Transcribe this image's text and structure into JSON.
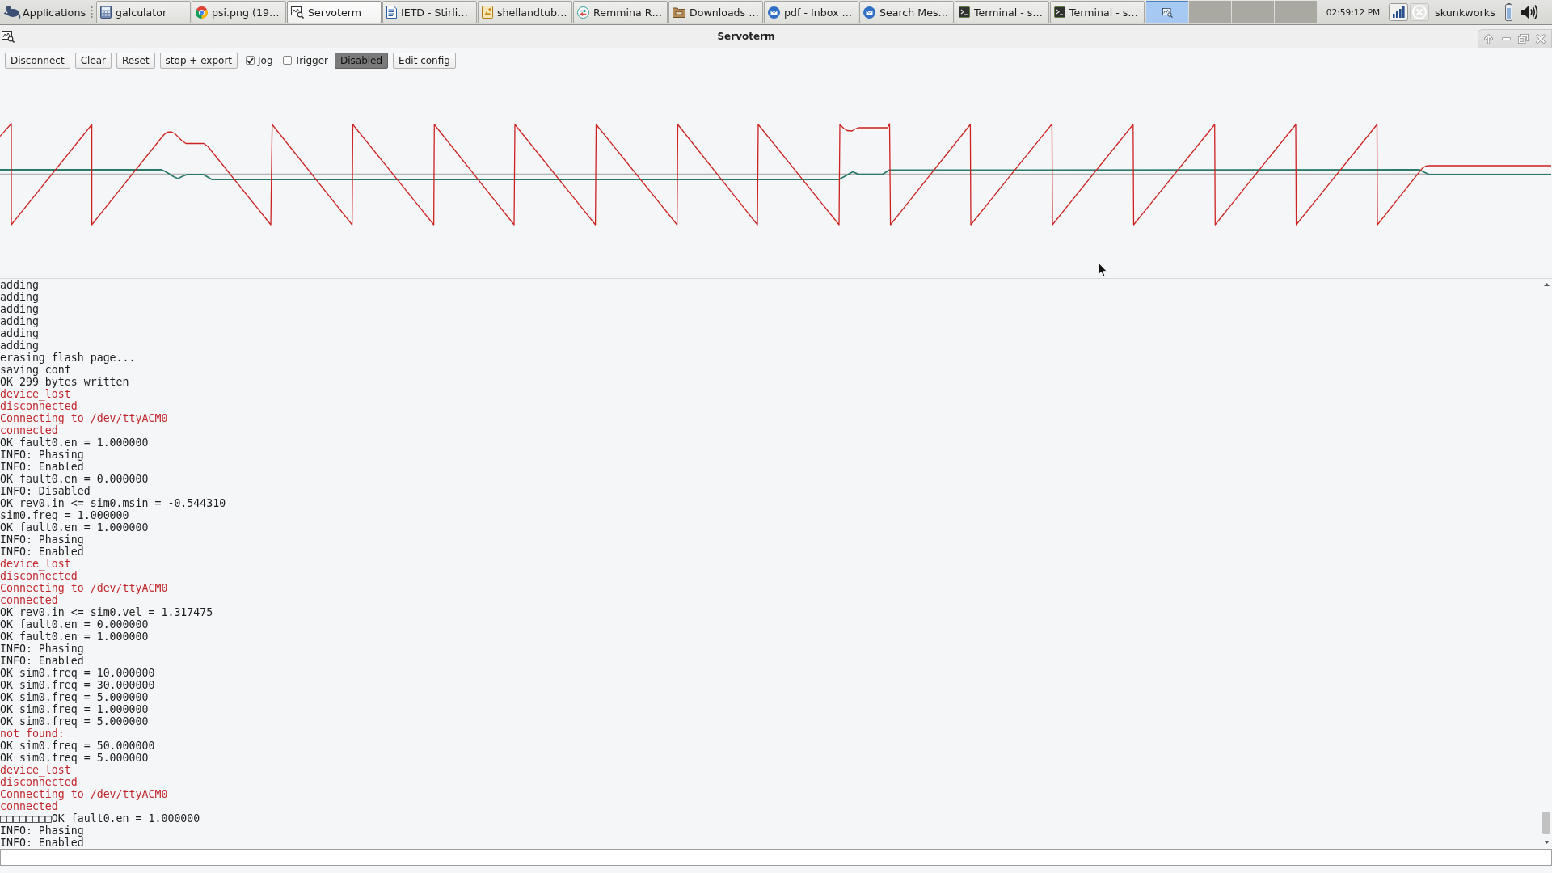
{
  "taskbar": {
    "menu": {
      "label": "Applications"
    },
    "tasks": [
      {
        "label": "galculator",
        "selected": false
      },
      {
        "label": "psi.png (19…",
        "selected": false
      },
      {
        "label": "Servoterm",
        "selected": true
      },
      {
        "label": "IETD - Stirli…",
        "selected": false
      },
      {
        "label": "shellandtub…",
        "selected": false
      },
      {
        "label": "Remmina R…",
        "selected": false
      },
      {
        "label": "Downloads …",
        "selected": false
      },
      {
        "label": "pdf - Inbox …",
        "selected": false
      },
      {
        "label": "Search Mes…",
        "selected": false
      },
      {
        "label": "Terminal - s…",
        "selected": false
      },
      {
        "label": "Terminal - s…",
        "selected": false
      }
    ],
    "workspaces": [
      {
        "selected": true
      },
      {
        "selected": false
      },
      {
        "selected": false
      },
      {
        "selected": false
      }
    ],
    "clock": "02:59:12 PM",
    "user": "skunkworks"
  },
  "window": {
    "title": "Servoterm"
  },
  "toolbar": [
    {
      "kind": "button",
      "label": "Disconnect",
      "pressed": false
    },
    {
      "kind": "button",
      "label": "Clear",
      "pressed": false
    },
    {
      "kind": "button",
      "label": "Reset",
      "pressed": false
    },
    {
      "kind": "button",
      "label": "stop + export",
      "pressed": false
    },
    {
      "kind": "checkbox",
      "label": "Jog",
      "checked": true
    },
    {
      "kind": "checkbox",
      "label": "Trigger",
      "checked": false
    },
    {
      "kind": "button",
      "label": "Disabled",
      "pressed": true
    },
    {
      "kind": "button",
      "label": "Edit config",
      "pressed": false
    }
  ],
  "log": [
    {
      "kind": "reply",
      "text": "adding"
    },
    {
      "kind": "reply",
      "text": "adding"
    },
    {
      "kind": "reply",
      "text": "adding"
    },
    {
      "kind": "reply",
      "text": "adding"
    },
    {
      "kind": "reply",
      "text": "adding"
    },
    {
      "kind": "reply",
      "text": "adding"
    },
    {
      "kind": "reply",
      "text": "erasing flash page..."
    },
    {
      "kind": "reply",
      "text": "saving conf"
    },
    {
      "kind": "reply",
      "text": "OK 299 bytes written"
    },
    {
      "kind": "status",
      "text": "device_lost"
    },
    {
      "kind": "status",
      "text": "disconnected"
    },
    {
      "kind": "status",
      "text": "Connecting to /dev/ttyACM0"
    },
    {
      "kind": "status",
      "text": "connected"
    },
    {
      "kind": "reply",
      "text": "OK fault0.en = 1.000000"
    },
    {
      "kind": "reply",
      "text": "INFO: Phasing"
    },
    {
      "kind": "reply",
      "text": "INFO: Enabled"
    },
    {
      "kind": "reply",
      "text": "OK fault0.en = 0.000000"
    },
    {
      "kind": "reply",
      "text": "INFO: Disabled"
    },
    {
      "kind": "reply",
      "text": "OK rev0.in <= sim0.msin = -0.544310"
    },
    {
      "kind": "reply",
      "text": "sim0.freq = 1.000000"
    },
    {
      "kind": "reply",
      "text": "OK fault0.en = 1.000000"
    },
    {
      "kind": "reply",
      "text": "INFO: Phasing"
    },
    {
      "kind": "reply",
      "text": "INFO: Enabled"
    },
    {
      "kind": "status",
      "text": "device_lost"
    },
    {
      "kind": "status",
      "text": "disconnected"
    },
    {
      "kind": "status",
      "text": "Connecting to /dev/ttyACM0"
    },
    {
      "kind": "status",
      "text": "connected"
    },
    {
      "kind": "reply",
      "text": "OK rev0.in <= sim0.vel = 1.317475"
    },
    {
      "kind": "reply",
      "text": "OK fault0.en = 0.000000"
    },
    {
      "kind": "reply",
      "text": "OK fault0.en = 1.000000"
    },
    {
      "kind": "reply",
      "text": "INFO: Phasing"
    },
    {
      "kind": "reply",
      "text": "INFO: Enabled"
    },
    {
      "kind": "reply",
      "text": "OK sim0.freq = 10.000000"
    },
    {
      "kind": "reply",
      "text": "OK sim0.freq = 30.000000"
    },
    {
      "kind": "reply",
      "text": "OK sim0.freq = 5.000000"
    },
    {
      "kind": "reply",
      "text": "OK sim0.freq = 1.000000"
    },
    {
      "kind": "reply",
      "text": "OK sim0.freq = 5.000000"
    },
    {
      "kind": "status",
      "text": "not found:"
    },
    {
      "kind": "reply",
      "text": "OK sim0.freq = 50.000000"
    },
    {
      "kind": "reply",
      "text": "OK sim0.freq = 5.000000"
    },
    {
      "kind": "status",
      "text": "device_lost"
    },
    {
      "kind": "status",
      "text": "disconnected"
    },
    {
      "kind": "status",
      "text": "Connecting to /dev/ttyACM0"
    },
    {
      "kind": "status",
      "text": "connected"
    },
    {
      "kind": "reply",
      "text": "□□□□□□□□OK fault0.en = 1.000000"
    },
    {
      "kind": "reply",
      "text": "INFO: Phasing"
    },
    {
      "kind": "reply",
      "text": "INFO: Enabled"
    }
  ]
}
